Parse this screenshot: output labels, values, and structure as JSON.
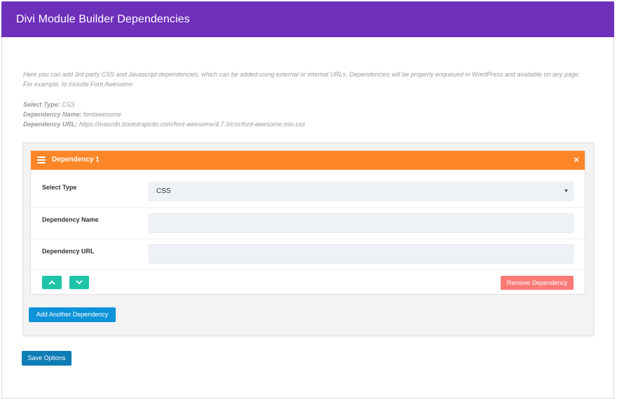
{
  "header": {
    "title": "Divi Module Builder Dependencies"
  },
  "intro": {
    "line1": "Here you can add 3rd party CSS and Javascript dependencies, which can be added using external or internal URLs. Dependencies will be properly enqueued in WordPress and available on any page.",
    "line2": "For example, to include Font Awesome:"
  },
  "example": {
    "type_label": "Select Type:",
    "type_value": "CSS",
    "name_label": "Dependency Name:",
    "name_value": "fontawesome",
    "url_label": "Dependency URL:",
    "url_value": "https://maxcdn.bootstrapcdn.com/font-awesome/4.7.0/css/font-awesome.min.css"
  },
  "dependency": {
    "title": "Dependency 1",
    "close_glyph": "×",
    "select_type_label": "Select Type",
    "select_type_value": "CSS",
    "select_caret": "▼",
    "name_label": "Dependency Name",
    "name_value": "",
    "url_label": "Dependency URL",
    "url_value": "",
    "remove_label": "Remove Dependency"
  },
  "buttons": {
    "add_label": "Add Another Dependency",
    "save_label": "Save Options"
  },
  "colors": {
    "header": "#6e2fbb",
    "dependency_header": "#fd8728",
    "move_buttons": "#1dc4a5",
    "remove_button": "#fa7a76",
    "add_button": "#0d94d8",
    "save_button": "#0e7db6"
  },
  "icons": {
    "drag": "hamburger-icon",
    "close": "close-icon",
    "move_up": "chevron-up-icon",
    "move_down": "chevron-down-icon"
  }
}
